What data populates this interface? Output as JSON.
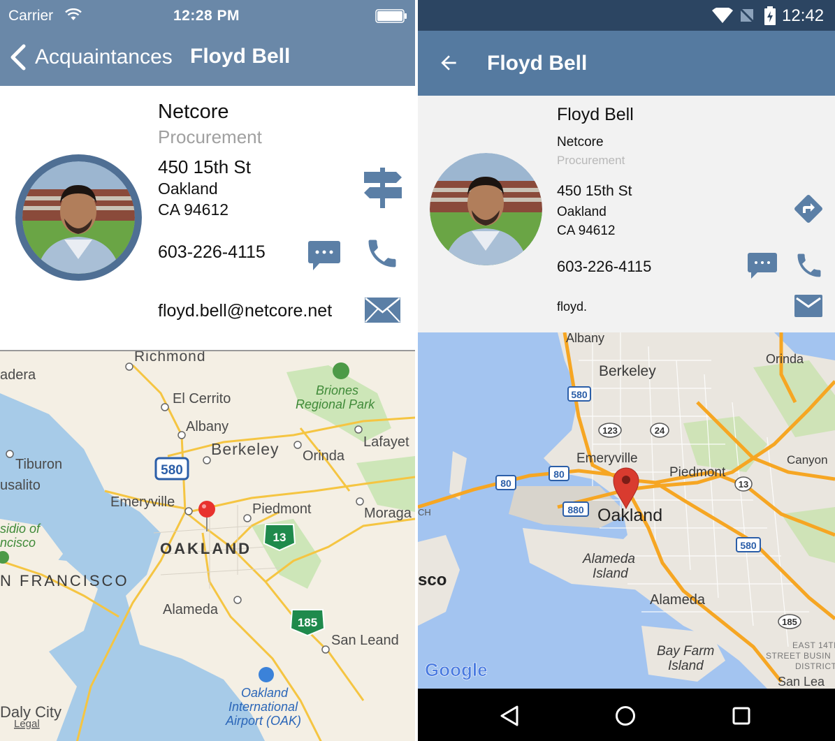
{
  "ios": {
    "status": {
      "carrier": "Carrier",
      "time": "12:28 PM"
    },
    "nav": {
      "back_label": "Acquaintances",
      "title": "Floyd Bell"
    },
    "card": {
      "company": "Netcore",
      "department": "Procurement",
      "street": "450 15th St",
      "city": "Oakland",
      "state_zip": "CA 94612",
      "phone": "603-226-4115",
      "email": "floyd.bell@netcore.net"
    },
    "map": {
      "labels": {
        "richmond": "Richmond",
        "adera": "adera",
        "el_cerrito": "El Cerrito",
        "briones": "Briones",
        "briones2": "Regional Park",
        "albany": "Albany",
        "berkeley": "Berkeley",
        "orinda": "Orinda",
        "lafayette": "Lafayet",
        "tiburon": "Tiburon",
        "sausalito": "usalito",
        "emeryville": "Emeryville",
        "piedmont": "Piedmont",
        "moraga": "Moraga",
        "presidio": "sidio of",
        "presidio2": "ncisco",
        "oakland": "OAKLAND",
        "sf": "N FRANCISCO",
        "alameda": "Alameda",
        "san_leandro": "San Leand",
        "oak_airport1": "Oakland",
        "oak_airport2": "International",
        "oak_airport3": "Airport (OAK)",
        "daly_city": "Daly City",
        "legal": "Legal",
        "shield_580": "580",
        "shield_13": "13",
        "shield_185": "185"
      }
    }
  },
  "android": {
    "status": {
      "time": "12:42"
    },
    "bar": {
      "title": "Floyd Bell"
    },
    "card": {
      "name": "Floyd Bell",
      "company": "Netcore",
      "department": "Procurement",
      "street": "450 15th St",
      "city": "Oakland",
      "state_zip": "CA 94612",
      "phone": "603-226-4115",
      "email": "floyd."
    },
    "map": {
      "labels": {
        "albany": "Albany",
        "orinda": "Orinda",
        "berkeley": "Berkeley",
        "emeryville": "Emeryville",
        "piedmont": "Piedmont",
        "canyon": "Canyon",
        "oakland": "Oakland",
        "alameda_island1": "Alameda",
        "alameda_island2": "Island",
        "alameda": "Alameda",
        "sco": "sco",
        "ch": "CH",
        "bay_farm1": "Bay Farm",
        "bay_farm2": "Island",
        "east14": "EAST 14TH",
        "east14b": "STREET BUSIN",
        "east14c": "DISTRICT",
        "san_lea": "San Lea",
        "google": "Google",
        "shield_580a": "580",
        "shield_580b": "580",
        "shield_80a": "80",
        "shield_80b": "80",
        "shield_880": "880",
        "shield_123": "123",
        "shield_24": "24",
        "shield_13": "13",
        "shield_185": "185"
      }
    }
  },
  "colors": {
    "ios_bar": "#6a88a8",
    "android_bar": "#557aa0",
    "android_status": "#2c4562",
    "icon_blue": "#5b7fa6"
  }
}
